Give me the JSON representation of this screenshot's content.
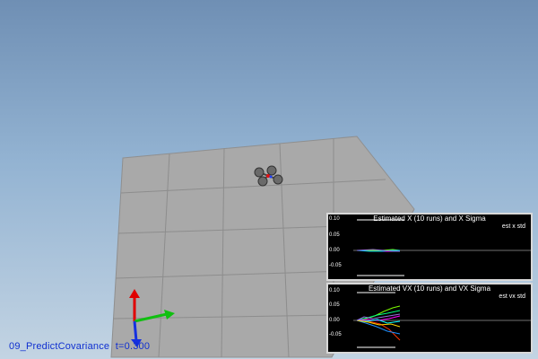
{
  "status": {
    "scenario": "09_PredictCovariance",
    "time": "t=0.300"
  },
  "plots": [
    {
      "title": "Estimated X (10 runs) and X Sigma",
      "legend": "est x std",
      "ticks": [
        "0.10",
        "0.05",
        "0.00",
        "-0.05"
      ]
    },
    {
      "title": "Estimated VX (10 runs) and VX Sigma",
      "legend": "est vx std",
      "ticks": [
        "0.10",
        "0.05",
        "0.00",
        "-0.05"
      ]
    }
  ],
  "colors": {
    "sky_top": "#6f8fb4",
    "ground": "#a9a9a9",
    "plot_bg": "#000000",
    "status_text": "#0f2fd0"
  }
}
